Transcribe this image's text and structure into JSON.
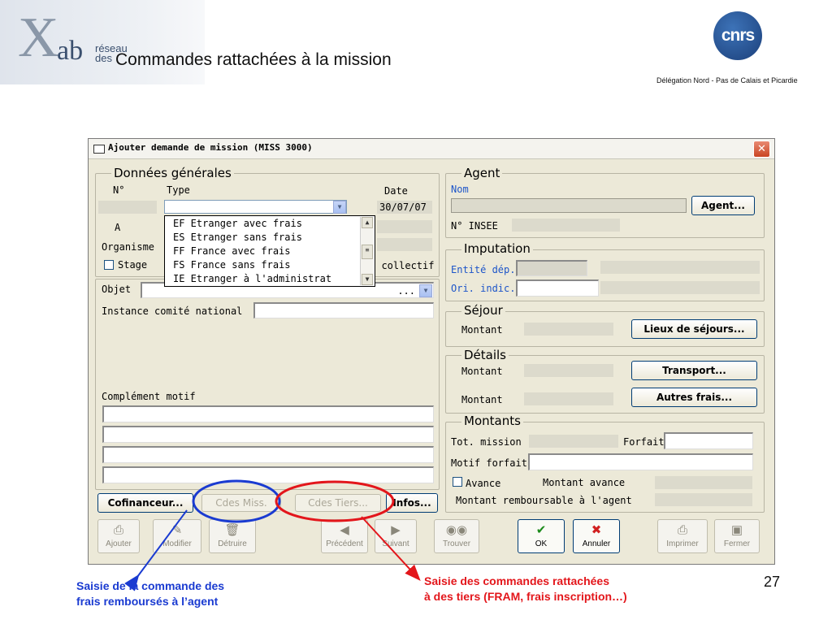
{
  "slide": {
    "logo_letter": "X",
    "logo_word": "ab",
    "logo_line1": "réseau",
    "logo_line2": "des",
    "title": "Commandes rattachées à la mission",
    "cnrs_logo": "cnrs",
    "cnrs_subtitle": "Délégation Nord - Pas de Calais et Picardie",
    "page_number": "27"
  },
  "window": {
    "title": "Ajouter demande de mission   (MISS 3000)",
    "close_glyph": "✕"
  },
  "donnees": {
    "legend": "Données générales",
    "no_label": "N°",
    "type_label": "Type",
    "date_label": "Date",
    "date_value": "30/07/07",
    "a_label": "A",
    "organisme_label": "Organisme",
    "stage_label": "Stage",
    "collectif_label": "M collectif",
    "type_options": [
      "EF Etranger avec frais",
      "ES Etranger sans frais",
      "FF France avec frais",
      "FS France sans frais",
      "IE Etranger à l'administrat"
    ],
    "objet_label": "Objet",
    "objet_value": "...",
    "instance_label": "Instance comité national",
    "complement_label": "Complément motif"
  },
  "agent": {
    "legend": "Agent",
    "nom_label": "Nom",
    "agent_button": "Agent...",
    "insee_label": "N° INSEE"
  },
  "imputation": {
    "legend": "Imputation",
    "entite_label": "Entité dép.",
    "ori_label": "Ori. indic."
  },
  "sejour": {
    "legend": "Séjour",
    "montant_label": "Montant",
    "lieux_button": "Lieux de séjours..."
  },
  "details": {
    "legend": "Détails",
    "montant1_label": "Montant",
    "transport_button": "Transport...",
    "montant2_label": "Montant",
    "autres_button": "Autres frais..."
  },
  "montants": {
    "legend": "Montants",
    "tot_label": "Tot. mission",
    "forfait_label": "Forfait",
    "motif_label": "Motif forfait",
    "avance_label": "Avance",
    "montant_avance_label": "Montant avance",
    "remboursable_label": "Montant remboursable à l'agent"
  },
  "bottom_buttons": {
    "cofinanceur": "Cofinanceur...",
    "cdes_miss": "Cdes Miss.",
    "cdes_tiers": "Cdes Tiers...",
    "infos": "Infos..."
  },
  "toolbar": {
    "ajouter": "Ajouter",
    "modifier": "Modifier",
    "detruire": "Détruire",
    "precedent": "Précédent",
    "suivant": "Suivant",
    "trouver": "Trouver",
    "ok": "OK",
    "annuler": "Annuler",
    "imprimer": "Imprimer",
    "fermer": "Fermer"
  },
  "annotations": {
    "blue_line1": "Saisie de la commande des",
    "blue_line2": "frais remboursés à l’agent",
    "red_line1": "Saisie des commandes rattachées",
    "red_line2": "à des tiers (FRAM, frais inscription…)"
  },
  "colors": {
    "annotation_blue": "#1a3bd1",
    "annotation_red": "#e3161b",
    "label_blue": "#1d55c9",
    "window_bg": "#ece9d8"
  }
}
